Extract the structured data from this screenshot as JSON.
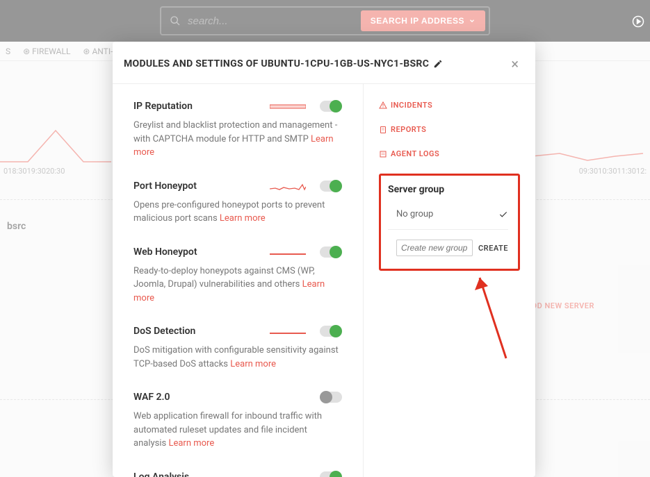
{
  "topbar": {
    "search_placeholder": "search...",
    "search_button": "SEARCH IP ADDRESS"
  },
  "bg": {
    "tabs": [
      "S",
      "FIREWALL",
      "ANTI-"
    ],
    "times_left": [
      "0",
      "18:30",
      "19:30",
      "20:30"
    ],
    "times_right": [
      "09:30",
      "10:30",
      "11:30",
      "12:"
    ],
    "server_name": "bsrc",
    "add_server": "ADD NEW SERVER"
  },
  "modal": {
    "title": "MODULES AND SETTINGS OF UBUNTU-1CPU-1GB-US-NYC1-BSRC",
    "learn_more": "Learn more",
    "modules": [
      {
        "name": "IP Reputation",
        "desc": "Greylist and blacklist protection and management - with CAPTCHA module for HTTP and SMTP",
        "on": true,
        "spark": "flat"
      },
      {
        "name": "Port Honeypot",
        "desc": "Opens pre-configured honeypot ports to prevent malicious port scans",
        "on": true,
        "spark": "jag"
      },
      {
        "name": "Web Honeypot",
        "desc": "Ready-to-deploy honeypots against CMS (WP, Joomla, Drupal) vulnerabilities and others",
        "on": true,
        "spark": "flatline"
      },
      {
        "name": "DoS Detection",
        "desc": "DoS mitigation with configurable sensitivity against TCP-based DoS attacks",
        "on": true,
        "spark": "flatline"
      },
      {
        "name": "WAF 2.0",
        "desc": "Web application firewall for inbound traffic with automated ruleset updates and file incident analysis",
        "on": false,
        "spark": "none"
      },
      {
        "name": "Log Analysis",
        "desc": "",
        "on": true,
        "spark": "flatline"
      }
    ],
    "nav": [
      {
        "label": "INCIDENTS",
        "icon": "warning"
      },
      {
        "label": "REPORTS",
        "icon": "doc"
      },
      {
        "label": "AGENT LOGS",
        "icon": "list"
      }
    ],
    "server_group": {
      "title": "Server group",
      "current": "No group",
      "input_placeholder": "Create new group",
      "create_label": "CREATE"
    }
  }
}
